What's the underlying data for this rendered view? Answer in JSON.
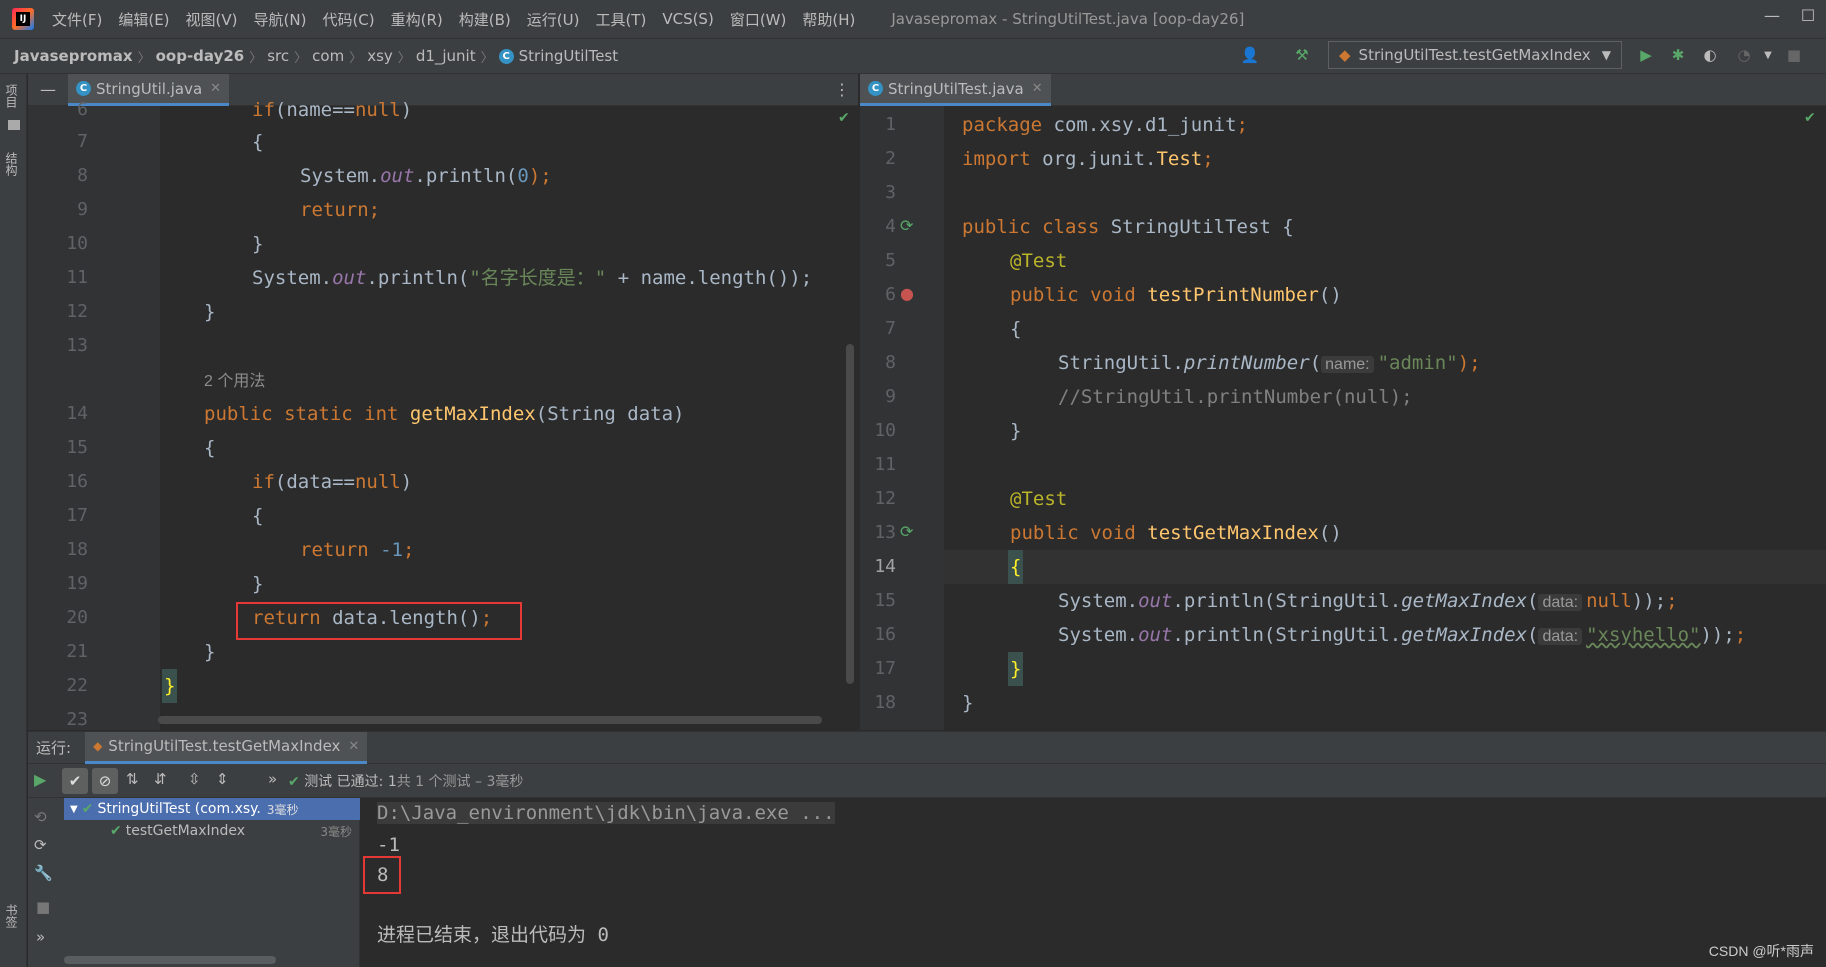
{
  "titlebar": {
    "menu": [
      "文件(F)",
      "编辑(E)",
      "视图(V)",
      "导航(N)",
      "代码(C)",
      "重构(R)",
      "构建(B)",
      "运行(U)",
      "工具(T)",
      "VCS(S)",
      "窗口(W)",
      "帮助(H)"
    ],
    "window_title": "Javasepromax - StringUtilTest.java [oop-day26]",
    "minimize": "—",
    "maximize": "☐",
    "close": "✕"
  },
  "breadcrumb": [
    "Javasepromax",
    "oop-day26",
    "src",
    "com",
    "xsy",
    "d1_junit",
    "StringUtilTest"
  ],
  "toolbar": {
    "run_config": "StringUtilTest.testGetMaxIndex"
  },
  "left_stripe": {
    "project": "项目",
    "structure": "结构",
    "bookmarks": "书签"
  },
  "left_editor": {
    "tab": "StringUtil.java",
    "usages_hint": "2 个用法",
    "line_numbers": [
      "6",
      "7",
      "8",
      "9",
      "10",
      "11",
      "12",
      "13",
      "",
      "14",
      "15",
      "16",
      "17",
      "18",
      "19",
      "20",
      "21",
      "22",
      "23"
    ],
    "lines": {
      "l6a": "if",
      "l6b": "(name==",
      "l6c": "null",
      "l6d": ")",
      "l7": "{",
      "l8a": "System.",
      "l8b": "out",
      "l8c": ".println(",
      "l8d": "0",
      "l8e": ");",
      "l9": "return;",
      "l10": "}",
      "l11a": "System.",
      "l11b": "out",
      "l11c": ".println(",
      "l11d": "\"名字长度是：\"",
      "l11e": " + name.length());",
      "l12": "}",
      "l14a": "public static int ",
      "l14b": "getMaxIndex",
      "l14c": "(String data)",
      "l15": "{",
      "l16a": "if",
      "l16b": "(data==",
      "l16c": "null",
      "l16d": ")",
      "l17": "{",
      "l18a": "return ",
      "l18b": "-1",
      "l18c": ";",
      "l19": "}",
      "l20a": "return ",
      "l20b": "data.length()",
      "l20c": ";",
      "l21": "}",
      "l22": "}"
    }
  },
  "right_editor": {
    "tab": "StringUtilTest.java",
    "line_numbers": [
      "1",
      "2",
      "3",
      "4",
      "5",
      "6",
      "7",
      "8",
      "9",
      "10",
      "11",
      "12",
      "13",
      "14",
      "15",
      "16",
      "17",
      "18"
    ],
    "lines": {
      "r1a": "package ",
      "r1b": "com.xsy.d1_junit",
      "r1c": ";",
      "r2a": "import ",
      "r2b": "org.junit.",
      "r2c": "Test",
      "r2d": ";",
      "r4a": "public class ",
      "r4b": "StringUtilTest {",
      "r5": "@Test",
      "r6a": "public void ",
      "r6b": "testPrintNumber",
      "r6c": "()",
      "r7": "{",
      "r8a": "StringUtil.",
      "r8b": "printNumber",
      "r8c": "(",
      "r8hint": "name:",
      "r8d": "\"admin\"",
      "r8e": ");",
      "r9": "//StringUtil.printNumber(null);",
      "r10": "}",
      "r12": "@Test",
      "r13a": "public void ",
      "r13b": "testGetMaxIndex",
      "r13c": "()",
      "r14": "{",
      "r15a": "System.",
      "r15b": "out",
      "r15c": ".println(StringUtil.",
      "r15d": "getMaxIndex",
      "r15e": "(",
      "r15hint": "data:",
      "r15f": "null",
      "r15g": "));",
      "r16a": "System.",
      "r16b": "out",
      "r16c": ".println(StringUtil.",
      "r16d": "getMaxIndex",
      "r16e": "(",
      "r16hint": "data:",
      "r16f": "\"xsyhello\"",
      "r16g": "));",
      "r17": "}",
      "r18": "}"
    }
  },
  "run_panel": {
    "label": "运行:",
    "tab": "StringUtilTest.testGetMaxIndex",
    "status_prefix": "测试 已通过: ",
    "status_count": "1",
    "status_suffix": "共 1 个测试 – 3毫秒",
    "tree": [
      {
        "label": "StringUtilTest (com.xsy.",
        "time": "3毫秒"
      },
      {
        "label": "testGetMaxIndex",
        "time": "3毫秒"
      }
    ],
    "console": [
      "D:\\Java_environment\\jdk\\bin\\java.exe ...",
      "-1",
      "8",
      "",
      "进程已结束，退出代码为 0"
    ]
  },
  "watermark": "CSDN @听*雨声",
  "colors": {
    "background": "#2b2b2b",
    "panel": "#3c3f41",
    "keyword": "#cc7832",
    "method": "#ffc66d",
    "string": "#6a8759",
    "number": "#6897bb",
    "field": "#9876aa",
    "annotation": "#bbb529",
    "highlight_box": "#e53935",
    "pass_green": "#59a869"
  }
}
